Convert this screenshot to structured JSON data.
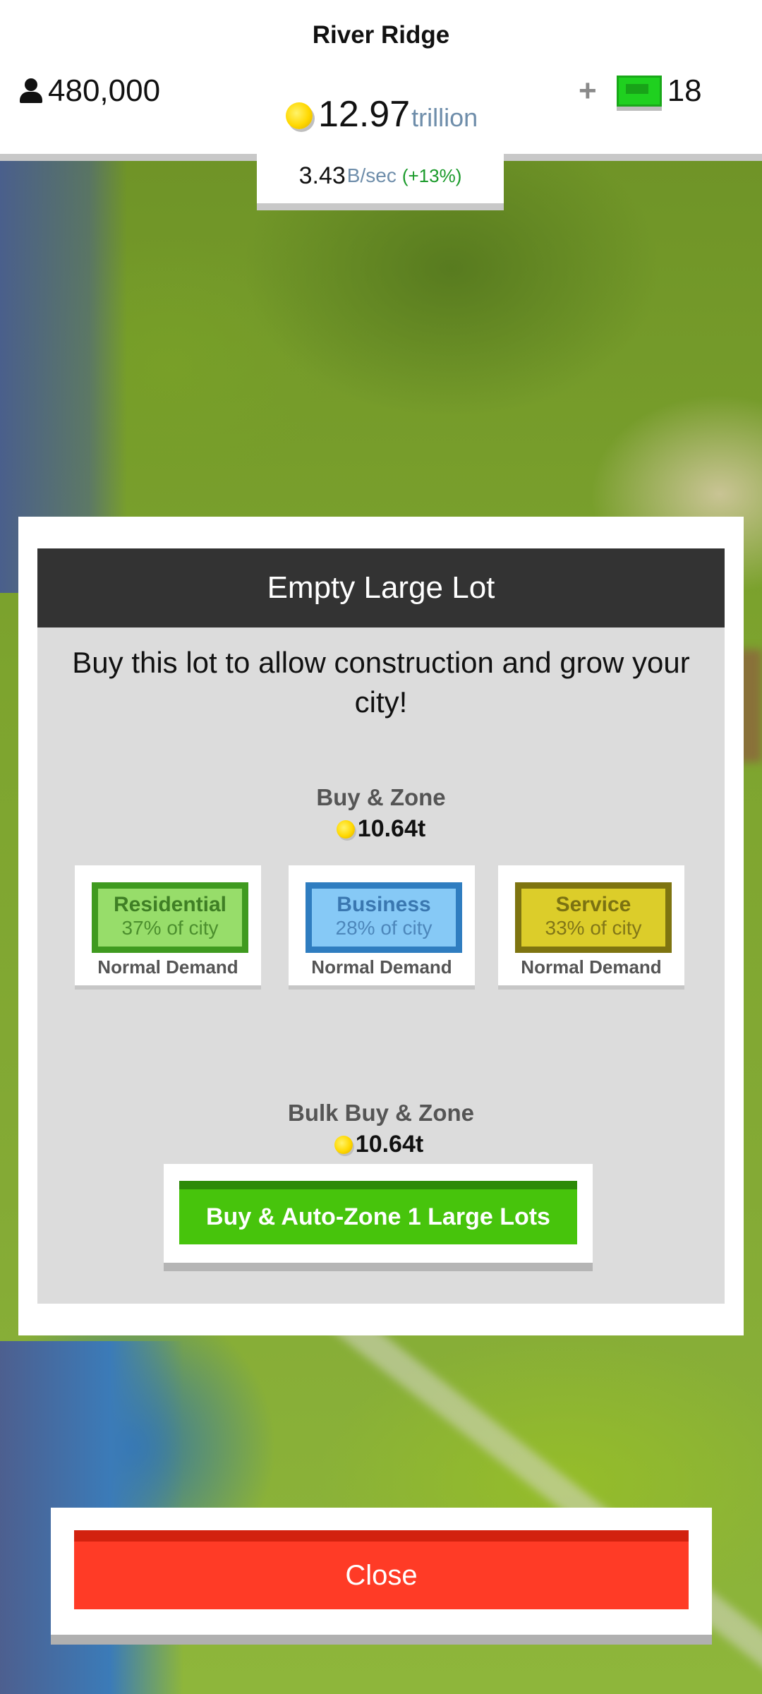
{
  "header": {
    "city_name": "River Ridge",
    "population": "480,000",
    "money_value": "12.97",
    "money_unit": "trillion",
    "income_value": "3.43",
    "income_unit": "B/sec",
    "income_change": "(+13%)",
    "cash_plus": "+",
    "cash_count": "18"
  },
  "dialog": {
    "title": "Empty Large Lot",
    "description": "Buy this lot to allow construction and grow your city!",
    "buy_zone_label": "Buy & Zone",
    "buy_zone_price": "10.64t",
    "zones": [
      {
        "name": "Residential",
        "share": "37% of city",
        "demand": "Normal Demand",
        "fill_color": "#97dd6a"
      },
      {
        "name": "Business",
        "share": "28% of city",
        "demand": "Normal Demand",
        "fill_color": "#86c9f6"
      },
      {
        "name": "Service",
        "share": "33% of city",
        "demand": "Normal Demand",
        "fill_color": "#dccd2a"
      }
    ],
    "bulk_label": "Bulk Buy & Zone",
    "bulk_price": "10.64t",
    "bulk_button": "Buy & Auto-Zone 1 Large Lots"
  },
  "footer": {
    "close_label": "Close",
    "close_color": "#ff3b26"
  },
  "icons": {
    "population": "person-icon",
    "money": "coin-icon",
    "cash": "cash-icon"
  }
}
